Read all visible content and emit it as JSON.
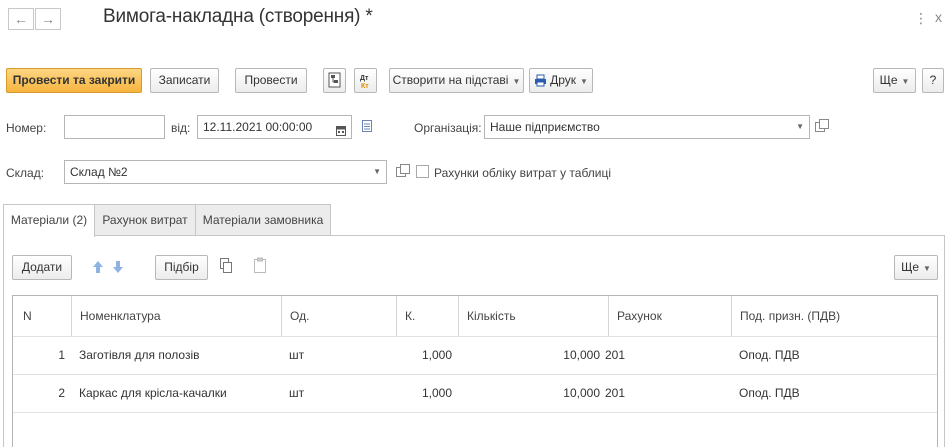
{
  "window": {
    "title": "Вимога-накладна (створення) *",
    "more_glyph": "⋮",
    "close_glyph": "x"
  },
  "nav": {
    "back_glyph": "←",
    "forward_glyph": "→"
  },
  "toolbar": {
    "post_close": "Провести та закрити",
    "save": "Записати",
    "post": "Провести",
    "create_based": "Створити на підставі",
    "print": "Друк",
    "more": "Ще",
    "help": "?"
  },
  "form": {
    "number_label": "Номер:",
    "number_value": "",
    "date_label": "від:",
    "date_value": "12.11.2021 00:00:00",
    "org_label": "Організація:",
    "org_value": "Наше підприємство",
    "warehouse_label": "Склад:",
    "warehouse_value": "Склад №2",
    "cost_accounts_checkbox": "Рахунки обліку витрат у таблиці",
    "cost_accounts_checked": false
  },
  "tabs": [
    {
      "label": "Матеріали (2)",
      "active": true
    },
    {
      "label": "Рахунок витрат",
      "active": false
    },
    {
      "label": "Матеріали замовника",
      "active": false
    }
  ],
  "table_toolbar": {
    "add": "Додати",
    "pick": "Підбір",
    "more": "Ще"
  },
  "table": {
    "columns": [
      "N",
      "Номенклатура",
      "Од.",
      "К.",
      "Кількість",
      "Рахунок",
      "Под. призн. (ПДВ)"
    ],
    "rows": [
      {
        "n": "1",
        "item": "Заготівля для полозів",
        "unit": "шт",
        "coef": "1,000",
        "qty": "10,000",
        "account": "201",
        "vat": "Опод. ПДВ"
      },
      {
        "n": "2",
        "item": "Каркас для крісла-качалки",
        "unit": "шт",
        "coef": "1,000",
        "qty": "10,000",
        "account": "201",
        "vat": "Опод. ПДВ"
      }
    ]
  },
  "colors": {
    "primary_button": "#f6b43e",
    "border": "#b5b5b5"
  }
}
